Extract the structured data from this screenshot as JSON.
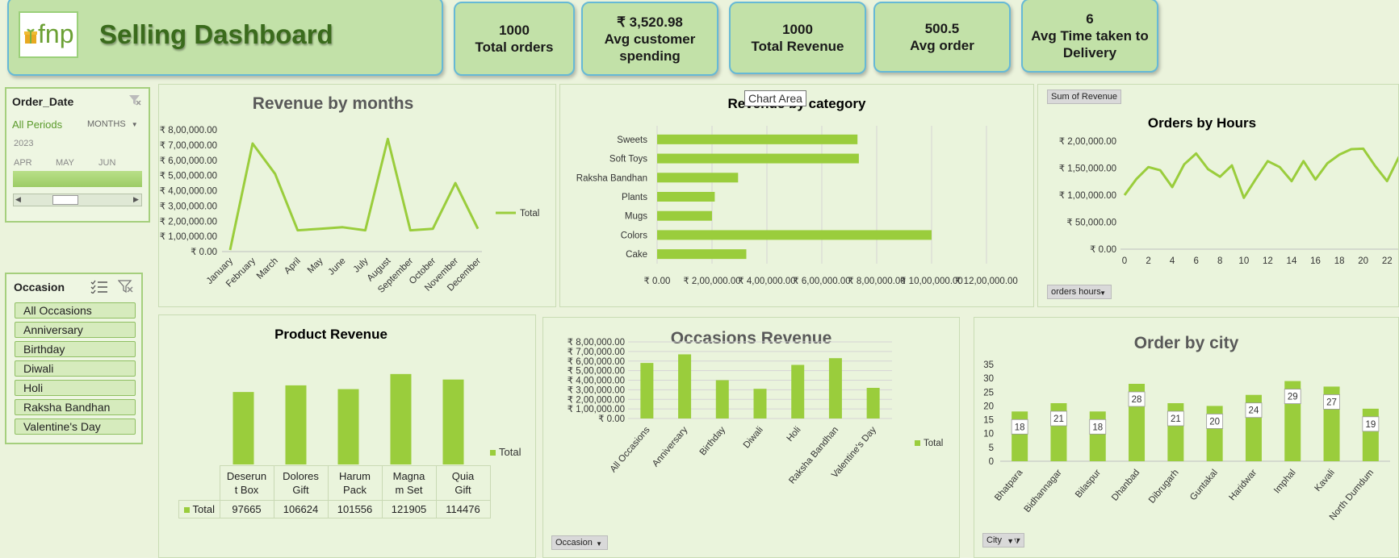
{
  "header": {
    "logo_text": "fnp",
    "title": "Selling Dashboard"
  },
  "kpis": [
    {
      "value": "1000",
      "label": "Total orders"
    },
    {
      "value": "₹ 3,520.98",
      "label": "Avg customer spending"
    },
    {
      "value": "1000",
      "label": "Total Revenue"
    },
    {
      "value": "500.5",
      "label": "Avg order"
    },
    {
      "value": "6",
      "label": "Avg Time taken to Delivery"
    }
  ],
  "order_date_slicer": {
    "title": "Order_Date",
    "period": "All Periods",
    "level": "MONTHS",
    "year": "2023",
    "months": [
      "APR",
      "MAY",
      "JUN"
    ]
  },
  "occasion_slicer": {
    "title": "Occasion",
    "items": [
      "All Occasions",
      "Anniversary",
      "Birthday",
      "Diwali",
      "Holi",
      "Raksha Bandhan",
      "Valentine's Day"
    ]
  },
  "tooltip": "Chart Area",
  "field_buttons": {
    "sum_of_revenue": "Sum of Revenue",
    "orders_hours": "orders hours",
    "occasion": "Occasion",
    "city": "City"
  },
  "colors": {
    "accent": "#9acd3c",
    "title_green": "#3a6b1c",
    "kpi_card": "#c2e1a8",
    "card_border": "#66b9d6"
  },
  "chart_data": [
    {
      "type": "line",
      "title": "Revenue by months",
      "categories": [
        "January",
        "February",
        "March",
        "April",
        "May",
        "June",
        "July",
        "August",
        "September",
        "October",
        "November",
        "December"
      ],
      "series": [
        {
          "name": "Total",
          "values": [
            100000,
            7100000,
            5100000,
            1400000,
            1500000,
            1600000,
            1400000,
            7400000,
            1400000,
            1500000,
            4500000,
            1500000
          ]
        }
      ],
      "ylim": [
        0,
        8000000
      ],
      "yticks": [
        "₹ 0.00",
        "₹ 1,00,000.00",
        "₹ 2,00,000.00",
        "₹ 3,00,000.00",
        "₹ 4,00,000.00",
        "₹ 5,00,000.00",
        "₹ 6,00,000.00",
        "₹ 7,00,000.00",
        "₹ 8,00,000.00"
      ],
      "legend": "right"
    },
    {
      "type": "bar",
      "orientation": "horizontal",
      "title": "Revenue by category",
      "categories": [
        "Sweets",
        "Soft Toys",
        "Raksha Bandhan",
        "Plants",
        "Mugs",
        "Colors",
        "Cake"
      ],
      "values": [
        730000,
        735000,
        295000,
        210000,
        200000,
        1000000,
        325000
      ],
      "xlim": [
        0,
        1200000
      ],
      "xticks": [
        "₹ 0.00",
        "₹ 2,00,000.00",
        "₹ 4,00,000.00",
        "₹ 6,00,000.00",
        "₹ 8,00,000.00",
        "₹ 10,00,000.00",
        "₹ 12,00,000.00"
      ]
    },
    {
      "type": "line",
      "title": "Orders by Hours",
      "x": [
        0,
        1,
        2,
        3,
        4,
        5,
        6,
        7,
        8,
        9,
        10,
        11,
        12,
        13,
        14,
        15,
        16,
        17,
        18,
        19,
        20,
        21,
        22,
        23
      ],
      "series": [
        {
          "name": "Sum of Revenue",
          "values": [
            100000,
            130000,
            152000,
            146000,
            115000,
            157000,
            177000,
            148000,
            134000,
            155000,
            95000,
            130000,
            163000,
            152000,
            126000,
            163000,
            129000,
            159000,
            175000,
            185000,
            186000,
            154000,
            126000,
            171000
          ]
        }
      ],
      "ylim": [
        0,
        200000
      ],
      "yticks": [
        "₹ 0.00",
        "₹ 50,000.00",
        "₹ 1,00,000.00",
        "₹ 1,50,000.00",
        "₹ 2,00,000.00"
      ],
      "xticks": [
        "0",
        "2",
        "4",
        "6",
        "8",
        "10",
        "12",
        "14",
        "16",
        "18",
        "20",
        "22"
      ]
    },
    {
      "type": "bar",
      "title": "Product Revenue",
      "categories": [
        "Deserunt Box",
        "Dolores Gift",
        "Harum Pack",
        "Magnam Set",
        "Quia Gift"
      ],
      "category_lines": [
        [
          "Deserun",
          "t Box"
        ],
        [
          "Dolores",
          "Gift"
        ],
        [
          "Harum",
          "Pack"
        ],
        [
          "Magna",
          "m Set"
        ],
        [
          "Quia",
          "Gift"
        ]
      ],
      "series": [
        {
          "name": "Total",
          "values": [
            97665,
            106624,
            101556,
            121905,
            114476
          ]
        }
      ],
      "table_labels": [
        "97665",
        "106624",
        "101556",
        "121905",
        "114476"
      ],
      "legend": "right"
    },
    {
      "type": "bar",
      "title": "Occasions Revenue",
      "categories": [
        "All Occasions",
        "Anniversary",
        "Birthday",
        "Diwali",
        "Holi",
        "Raksha Bandhan",
        "Valentine's Day"
      ],
      "series": [
        {
          "name": "Total",
          "values": [
            5800000,
            6700000,
            4000000,
            3100000,
            5600000,
            6300000,
            3200000
          ]
        }
      ],
      "ylim": [
        0,
        8000000
      ],
      "yticks": [
        "₹ 0.00",
        "₹ 1,00,000.00",
        "₹ 2,00,000.00",
        "₹ 3,00,000.00",
        "₹ 4,00,000.00",
        "₹ 5,00,000.00",
        "₹ 6,00,000.00",
        "₹ 7,00,000.00",
        "₹ 8,00,000.00"
      ],
      "legend": "right"
    },
    {
      "type": "bar",
      "title": "Order by city",
      "categories": [
        "Bhatpara",
        "Bidhannagar",
        "Bilaspur",
        "Dhanbad",
        "Dibrugarh",
        "Guntakal",
        "Haridwar",
        "Imphal",
        "Kavali",
        "North Dumdum"
      ],
      "values": [
        18,
        21,
        18,
        28,
        21,
        20,
        24,
        29,
        27,
        19
      ],
      "data_labels": [
        "18",
        "21",
        "18",
        "28",
        "21",
        "20",
        "24",
        "29",
        "27",
        "19"
      ],
      "ylim": [
        0,
        35
      ],
      "yticks": [
        "0",
        "5",
        "10",
        "15",
        "20",
        "25",
        "30",
        "35"
      ]
    }
  ]
}
